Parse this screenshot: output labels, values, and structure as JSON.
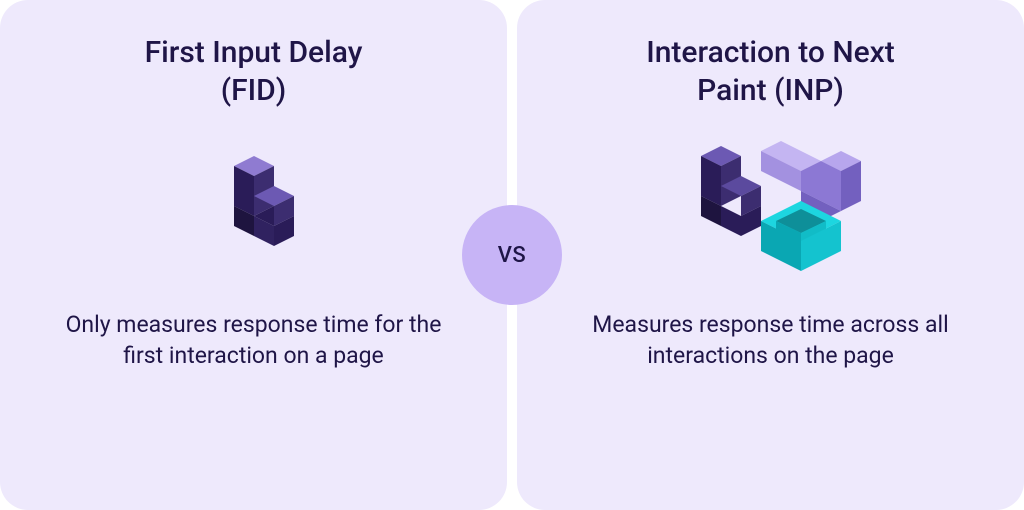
{
  "comparison": {
    "vs_label": "VS",
    "left": {
      "title": "First Input Delay\n(FID)",
      "description": "Only measures response time for the first interaction on a page"
    },
    "right": {
      "title": "Interaction to Next\nPaint (INP)",
      "description": "Measures response time across all interactions on the page"
    }
  },
  "colors": {
    "card_bg": "#EEE9FC",
    "badge_bg": "#C7B4F6",
    "text": "#1F1547",
    "cube_dark": "#2A1C58",
    "cube_purple_top": "#8F7BD1",
    "cube_purple_side": "#5B4A9E",
    "cube_light_top": "#B7A6ED",
    "cube_light_side": "#8C78D4",
    "cube_cyan": "#1DD6E0",
    "cube_cyan_dark": "#0AA7B3"
  }
}
